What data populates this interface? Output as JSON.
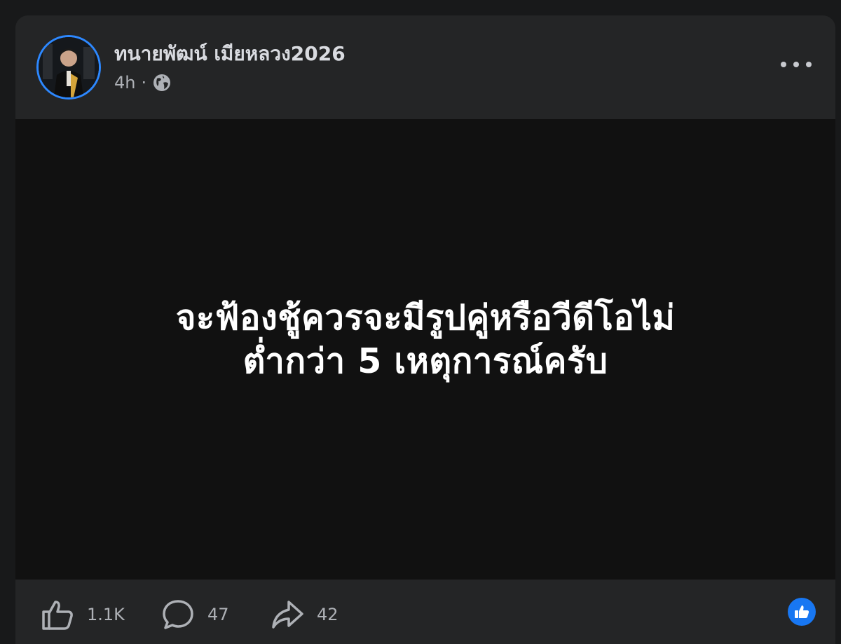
{
  "post": {
    "author": "ทนายพัฒน์ เมียหลวง2026",
    "time": "4h",
    "separator": "·",
    "privacy_icon": "globe-icon",
    "more_icon": "more-options-icon",
    "text_lines": [
      "จะฟ้องชู้ควรจะมีรูปคู่หรือวีดีโอไม่",
      "ต่ำกว่า 5 เหตุการณ์ครับ"
    ]
  },
  "footer": {
    "like_count": "1.1K",
    "comment_count": "47",
    "share_count": "42",
    "like_icon": "thumbs-up-icon",
    "comment_icon": "comment-bubble-icon",
    "share_icon": "share-arrow-icon",
    "reaction_icon": "like-reaction-icon"
  },
  "colors": {
    "page_background": "#18191a",
    "card_background": "#242526",
    "image_background": "#111111",
    "accent": "#1877f2"
  }
}
